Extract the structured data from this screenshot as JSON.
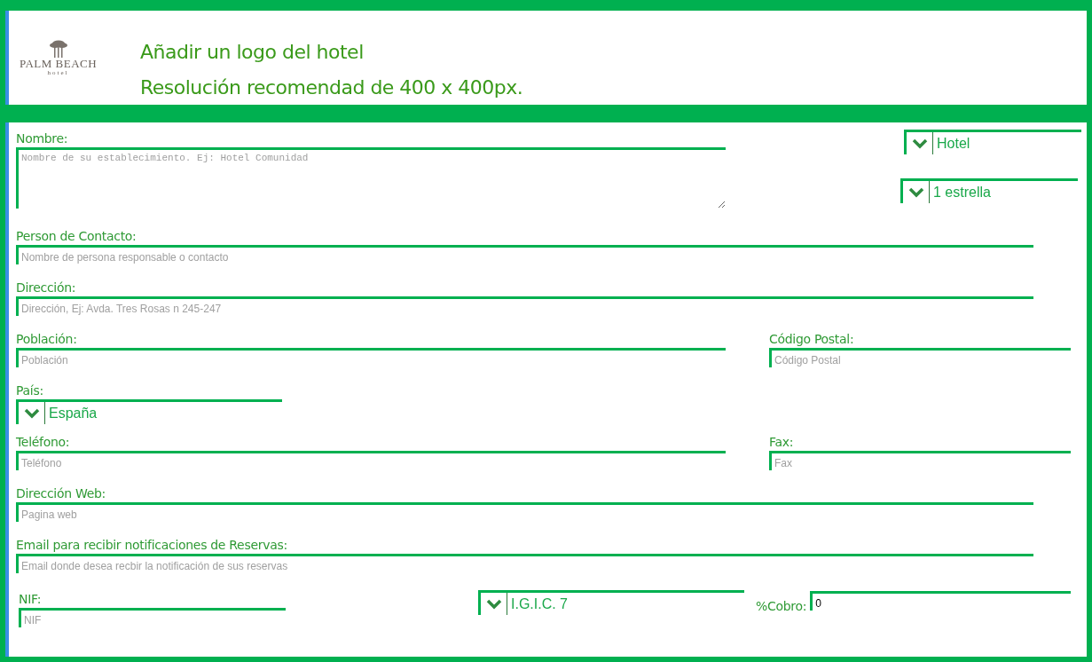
{
  "logo": {
    "brand": "PALM BEACH",
    "sub": "hotel"
  },
  "header": {
    "title": "Añadir un logo del hotel",
    "hint": "Resolución recomendad de 400 x 400px."
  },
  "name": {
    "label": "Nombre:",
    "placeholder": "Nombre de su establecimiento. Ej: Hotel Comunidad"
  },
  "type_select": {
    "value": "Hotel"
  },
  "stars_select": {
    "value": "1 estrella"
  },
  "contact": {
    "label": "Person de Contacto:",
    "placeholder": "Nombre de persona responsable o contacto"
  },
  "address": {
    "label": "Dirección:",
    "placeholder": "Dirección, Ej: Avda. Tres Rosas n 245-247"
  },
  "city": {
    "label": "Población:",
    "placeholder": "Población"
  },
  "postal_code": {
    "label": "Código Postal:",
    "placeholder": "Código Postal"
  },
  "country": {
    "label": "País:",
    "value": "España"
  },
  "phone": {
    "label": "Teléfono:",
    "placeholder": "Teléfono"
  },
  "fax": {
    "label": "Fax:",
    "placeholder": "Fax"
  },
  "web": {
    "label": "Dirección Web:",
    "placeholder": "Pagina web"
  },
  "email": {
    "label": "Email para recibir notificaciones de Reservas:",
    "placeholder": "Email donde desea recbir la notificación de sus reservas"
  },
  "nif": {
    "label": "NIF:",
    "placeholder": "NIF"
  },
  "tax_select": {
    "value": "I.G.I.C. 7"
  },
  "cobro": {
    "label": "%Cobro:",
    "value": "0"
  }
}
